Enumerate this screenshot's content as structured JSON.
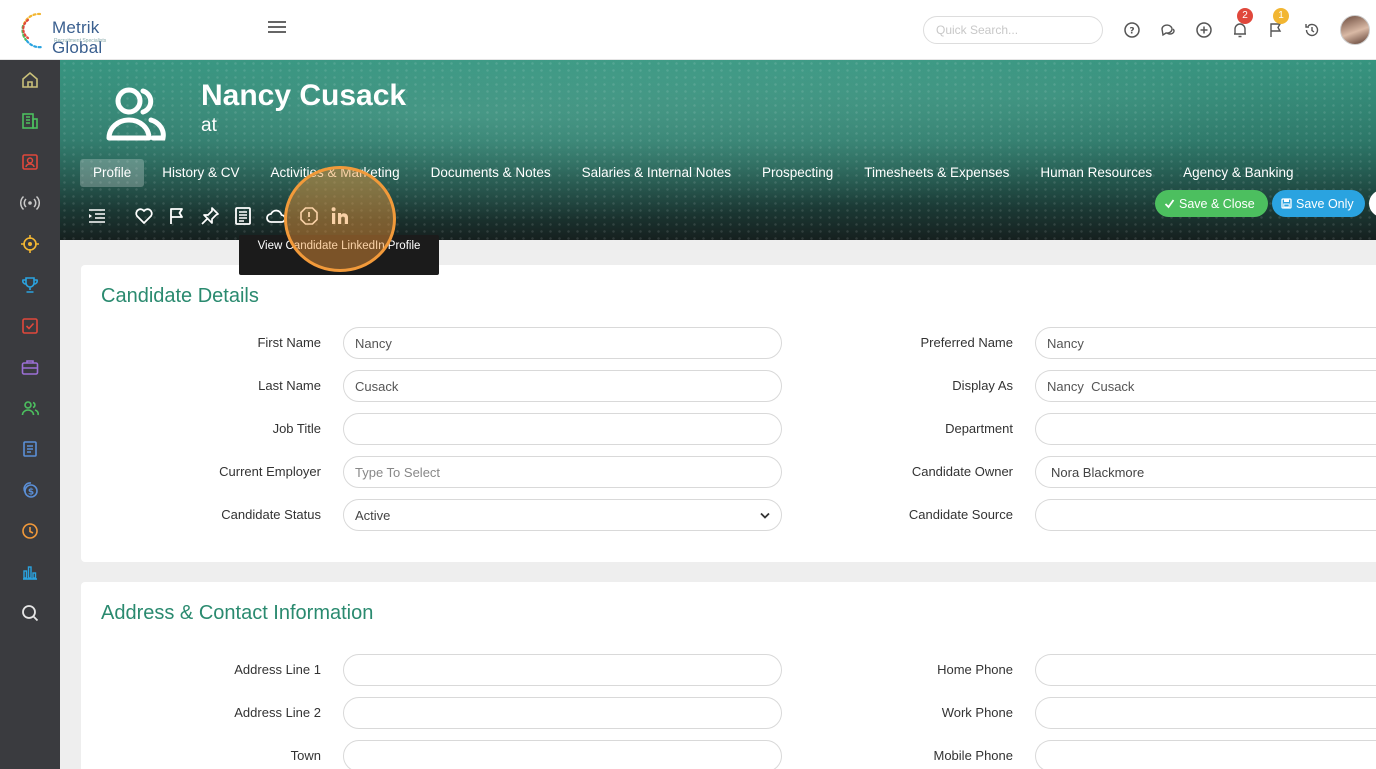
{
  "brand": {
    "name": "Metrik Global",
    "tagline": "Recruitment Specialists"
  },
  "search": {
    "placeholder": "Quick Search..."
  },
  "notifications": {
    "bell_count": "2",
    "flag_count": "1"
  },
  "header": {
    "name": "Nancy Cusack",
    "subtitle": "at"
  },
  "tabs": [
    {
      "label": "Profile"
    },
    {
      "label": "History & CV"
    },
    {
      "label": "Activities & Marketing"
    },
    {
      "label": "Documents & Notes"
    },
    {
      "label": "Salaries & Internal Notes"
    },
    {
      "label": "Prospecting"
    },
    {
      "label": "Timesheets & Expenses"
    },
    {
      "label": "Human Resources"
    },
    {
      "label": "Agency & Banking"
    }
  ],
  "actions": {
    "save_close": "Save & Close",
    "save_only": "Save Only"
  },
  "tooltip": {
    "text": "View Candidate LinkedIn Profile"
  },
  "colors": {
    "accent": "#2a8a6f",
    "save_close": "#4cbf5f",
    "save_only": "#2aa3e0",
    "highlight": "#f29a3a"
  },
  "candidate_details": {
    "title": "Candidate Details",
    "first_name": {
      "label": "First Name",
      "value": "Nancy"
    },
    "last_name": {
      "label": "Last Name",
      "value": "Cusack"
    },
    "job_title": {
      "label": "Job Title",
      "value": ""
    },
    "current_employer": {
      "label": "Current Employer",
      "value": "",
      "placeholder": "Type To Select"
    },
    "candidate_status": {
      "label": "Candidate Status",
      "value": "Active"
    },
    "preferred_name": {
      "label": "Preferred Name",
      "value": "Nancy"
    },
    "display_as": {
      "label": "Display As",
      "value": "Nancy  Cusack"
    },
    "department": {
      "label": "Department",
      "value": ""
    },
    "candidate_owner": {
      "label": "Candidate Owner",
      "value": "Nora Blackmore"
    },
    "candidate_source": {
      "label": "Candidate Source",
      "value": ""
    }
  },
  "address_contact": {
    "title": "Address & Contact Information",
    "address_line_1": {
      "label": "Address Line 1",
      "value": ""
    },
    "address_line_2": {
      "label": "Address Line 2",
      "value": ""
    },
    "town": {
      "label": "Town",
      "value": ""
    },
    "home_phone": {
      "label": "Home Phone",
      "value": ""
    },
    "work_phone": {
      "label": "Work Phone",
      "value": ""
    },
    "mobile_phone": {
      "label": "Mobile Phone",
      "value": ""
    }
  }
}
